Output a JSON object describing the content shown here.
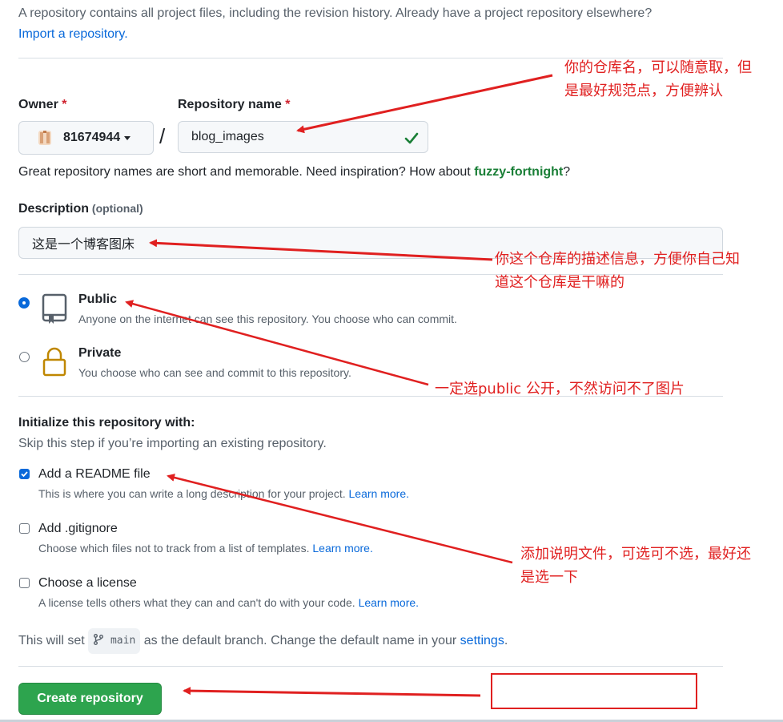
{
  "intro": {
    "text": "A repository contains all project files, including the revision history. Already have a project repository elsewhere?",
    "link": "Import a repository."
  },
  "owner": {
    "label": "Owner",
    "required": "*",
    "value": "81674944"
  },
  "repo_name": {
    "label": "Repository name",
    "required": "*",
    "value": "blog_images",
    "separator": "/"
  },
  "name_hint": {
    "prefix": "Great repository names are short and memorable. Need inspiration? How about ",
    "suggestion": "fuzzy-fortnight",
    "suffix": "?"
  },
  "description": {
    "label": "Description",
    "optional": "(optional)",
    "value": "这是一个博客图床"
  },
  "visibility": {
    "public": {
      "title": "Public",
      "sub": "Anyone on the internet can see this repository. You choose who can commit.",
      "selected": true
    },
    "private": {
      "title": "Private",
      "sub": "You choose who can see and commit to this repository.",
      "selected": false
    }
  },
  "init": {
    "heading": "Initialize this repository with:",
    "sub": "Skip this step if you’re importing an existing repository.",
    "readme": {
      "title": "Add a README file",
      "sub": "This is where you can write a long description for your project.",
      "link": "Learn more.",
      "checked": true
    },
    "gitignore": {
      "title": "Add .gitignore",
      "sub": "Choose which files not to track from a list of templates.",
      "link": "Learn more.",
      "checked": false
    },
    "license": {
      "title": "Choose a license",
      "sub": "A license tells others what they can and can't do with your code.",
      "link": "Learn more.",
      "checked": false
    }
  },
  "branch": {
    "prefix": "This will set",
    "name": "main",
    "middle": "as the default branch. Change the default name in your",
    "link": "settings",
    "suffix": "."
  },
  "create_button": "Create repository",
  "annotations": {
    "repo_name": [
      "你的仓库名，可以随意取，但",
      "是最好规范点，方便辨认"
    ],
    "description": [
      "你这个仓库的描述信息，方便你自己知",
      "道这个仓库是干嘛的"
    ],
    "public": "一定选public 公开，不然访问不了图片",
    "readme": [
      "添加说明文件，可选可不选，最好还",
      "是选一下"
    ]
  },
  "colors": {
    "accent": "#0969da",
    "success": "#2da44e",
    "annotation": "#e02020"
  }
}
